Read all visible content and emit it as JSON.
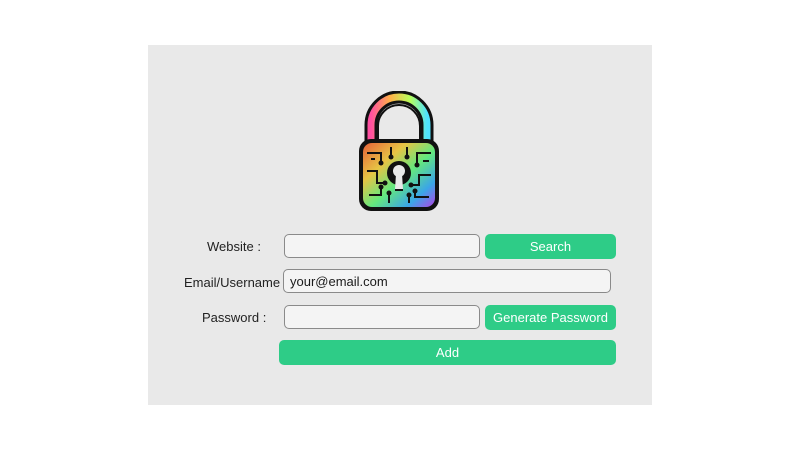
{
  "form": {
    "website_label": "Website :",
    "email_label": "Email/Username :",
    "password_label": "Password :",
    "website_value": "",
    "email_value": "your@email.com",
    "password_value": "",
    "search_label": "Search",
    "generate_label": "Generate Password",
    "add_label": "Add"
  },
  "logo": {
    "icon": "circuit-padlock-icon"
  },
  "colors": {
    "window_bg": "#e9e9e9",
    "accent": "#2ecc87",
    "button_text": "#ffffff"
  }
}
